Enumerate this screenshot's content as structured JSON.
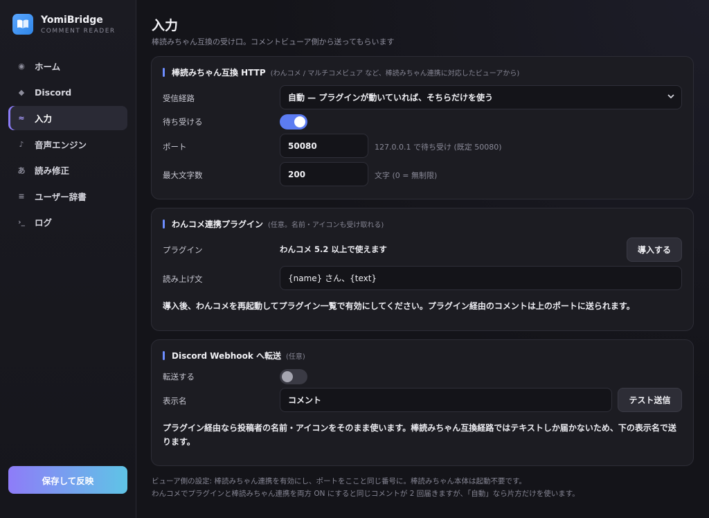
{
  "brand": {
    "name": "YomiBridge",
    "subtitle": "COMMENT READER"
  },
  "nav": [
    {
      "icon": "circle-icon",
      "glyph": "◉",
      "label": "ホーム",
      "active": false
    },
    {
      "icon": "diamond-icon",
      "glyph": "◆",
      "label": "Discord",
      "active": false
    },
    {
      "icon": "wave-icon",
      "glyph": "≈",
      "label": "入力",
      "active": true
    },
    {
      "icon": "music-note-icon",
      "glyph": "♪",
      "label": "音声エンジン",
      "active": false
    },
    {
      "icon": "hiragana-a-icon",
      "glyph": "あ",
      "label": "読み修正",
      "active": false
    },
    {
      "icon": "list-icon",
      "glyph": "≡",
      "label": "ユーザー辞書",
      "active": false
    },
    {
      "icon": "terminal-icon",
      "glyph": "›_",
      "label": "ログ",
      "active": false
    }
  ],
  "save_button": "保存して反映",
  "page": {
    "title": "入力",
    "subtitle": "棒読みちゃん互換の受け口。コメントビューア側から送ってもらいます"
  },
  "http_card": {
    "title": "棒読みちゃん互換 HTTP",
    "note": "(わんコメ / マルチコメビュア など、棒読みちゃん連携に対応したビューアから)",
    "route_label": "受信経路",
    "route_value": "自動 — プラグインが動いていれば、そちらだけを使う",
    "listen_label": "待ち受ける",
    "listen_on": true,
    "port_label": "ポート",
    "port_value": "50080",
    "port_hint": "127.0.0.1 で待ち受け (既定 50080)",
    "maxlen_label": "最大文字数",
    "maxlen_value": "200",
    "maxlen_hint": "文字 (0 = 無制限)"
  },
  "plugin_card": {
    "title": "わんコメ連携プラグイン",
    "note": "(任意。名前・アイコンも受け取れる)",
    "plugin_label": "プラグイン",
    "plugin_req": "わんコメ 5.2 以上で使えます",
    "install_button": "導入する",
    "readout_label": "読み上げ文",
    "readout_value": "{name} さん、{text}",
    "description": "導入後、わんコメを再起動してプラグイン一覧で有効にしてください。プラグイン経由のコメントは上のポートに送られます。"
  },
  "webhook_card": {
    "title": "Discord Webhook へ転送",
    "note": "(任意)",
    "forward_label": "転送する",
    "forward_on": false,
    "display_label": "表示名",
    "display_value": "コメント",
    "test_button": "テスト送信",
    "description": "プラグイン経由なら投稿者の名前・アイコンをそのまま使います。棒読みちゃん互換経路ではテキストしか届かないため、下の表示名で送ります。"
  },
  "footer": {
    "line1": "ビューア側の設定: 棒読みちゃん連携を有効にし、ポートをここと同じ番号に。棒読みちゃん本体は起動不要です。",
    "line2": "わんコメでプラグインと棒読みちゃん連携を両方 ON にすると同じコメントが 2 回届きますが、「自動」なら片方だけを使います。"
  },
  "colors": {
    "accent": "#6d8dff",
    "toggle_on": "#5c7cf2",
    "save_gradient_start": "#8e7cf8",
    "save_gradient_end": "#5fc4e6"
  }
}
